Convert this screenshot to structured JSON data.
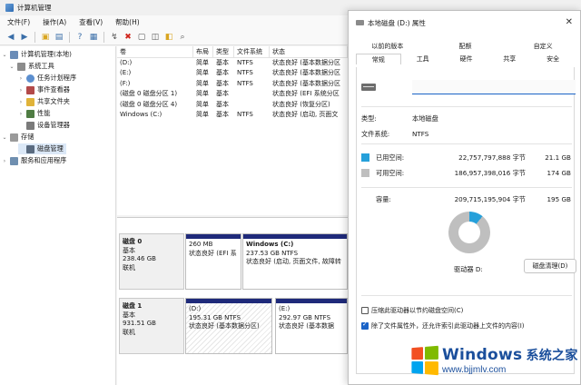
{
  "mgmt": {
    "title": "计算机管理",
    "menu": [
      "文件(F)",
      "操作(A)",
      "查看(V)",
      "帮助(H)"
    ],
    "tree": [
      {
        "label": "计算机管理(本地)",
        "level": 0,
        "twisty": "⌄"
      },
      {
        "label": "系统工具",
        "level": 1,
        "twisty": "⌄"
      },
      {
        "label": "任务计划程序",
        "level": 2,
        "twisty": "›"
      },
      {
        "label": "事件查看器",
        "level": 2,
        "twisty": "›"
      },
      {
        "label": "共享文件夹",
        "level": 2,
        "twisty": "›"
      },
      {
        "label": "性能",
        "level": 2,
        "twisty": "›"
      },
      {
        "label": "设备管理器",
        "level": 2,
        "twisty": ""
      },
      {
        "label": "存储",
        "level": 1,
        "twisty": "⌄"
      },
      {
        "label": "磁盘管理",
        "level": 2,
        "twisty": ""
      },
      {
        "label": "服务和应用程序",
        "level": 1,
        "twisty": "›"
      }
    ],
    "volume_columns": [
      "卷",
      "布局",
      "类型",
      "文件系统",
      "状态"
    ],
    "volumes": [
      [
        "(D:)",
        "简单",
        "基本",
        "NTFS",
        "状态良好 (基本数据分区"
      ],
      [
        "(E:)",
        "简单",
        "基本",
        "NTFS",
        "状态良好 (基本数据分区"
      ],
      [
        "(F:)",
        "简单",
        "基本",
        "NTFS",
        "状态良好 (基本数据分区"
      ],
      [
        "(磁盘 0 磁盘分区 1)",
        "简单",
        "基本",
        "",
        "状态良好 (EFI 系统分区"
      ],
      [
        "(磁盘 0 磁盘分区 4)",
        "简单",
        "基本",
        "",
        "状态良好 (恢复分区)"
      ],
      [
        "Windows (C:)",
        "简单",
        "基本",
        "NTFS",
        "状态良好 (启动, 页面文"
      ]
    ],
    "disks": [
      {
        "name": "磁盘 0",
        "type": "基本",
        "size": "238.46 GB",
        "status": "联机",
        "partitions": [
          {
            "title": "",
            "size": "260 MB",
            "status": "状态良好 (EFI 系"
          },
          {
            "title": "Windows (C:)",
            "size": "237.53 GB NTFS",
            "status": "状态良好 (启动, 页面文件, 故障转"
          }
        ]
      },
      {
        "name": "磁盘 1",
        "type": "基本",
        "size": "931.51 GB",
        "status": "联机",
        "partitions": [
          {
            "title": "(D:)",
            "size": "195.31 GB NTFS",
            "status": "状态良好 (基本数据分区)"
          },
          {
            "title": "(E:)",
            "size": "292.97 GB NTFS",
            "status": "状态良好 (基本数据"
          }
        ]
      }
    ]
  },
  "dialog": {
    "title": "本地磁盘 (D:) 属性",
    "close": "✕",
    "tabs_row1": [
      "以前的版本",
      "配额",
      "自定义"
    ],
    "tabs_row2": [
      "常规",
      "工具",
      "硬件",
      "共享",
      "安全"
    ],
    "name_value": "",
    "type_label": "类型:",
    "type_value": "本地磁盘",
    "fs_label": "文件系统:",
    "fs_value": "NTFS",
    "used_label": "已用空间:",
    "used_bytes": "22,757,797,888 字节",
    "used_size": "21.1 GB",
    "free_label": "可用空间:",
    "free_bytes": "186,957,398,016 字节",
    "free_size": "174 GB",
    "capacity_label": "容量:",
    "capacity_bytes": "209,715,195,904 字节",
    "capacity_size": "195 GB",
    "drive_label": "驱动器 D:",
    "cleanup_button": "磁盘清理(D)",
    "compress_label": "压缩此驱动器以节约磁盘空间(C)",
    "compress_checked": false,
    "index_label": "除了文件属性外，还允许索引此驱动器上文件的内容(I)",
    "index_checked": true,
    "used_fraction": 0.109,
    "colors": {
      "used": "#26a0da",
      "free": "#bfbfbf"
    }
  },
  "watermark": {
    "brand": "Windows",
    "brand_cn": "系统之家",
    "url": "www.bjjmlv.com",
    "logo_colors": [
      "#f25022",
      "#7fba00",
      "#00a4ef",
      "#ffb900"
    ]
  }
}
